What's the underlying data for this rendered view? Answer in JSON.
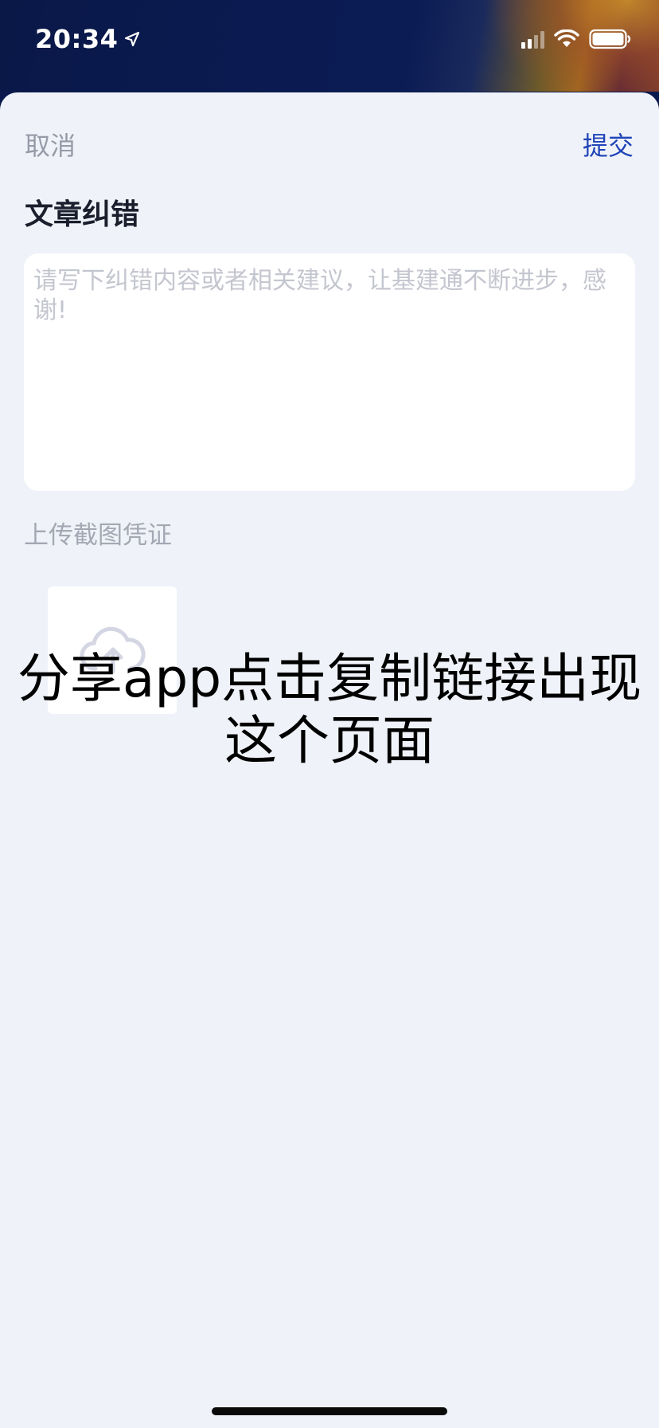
{
  "status_bar": {
    "time": "20:34",
    "icons": [
      "location-arrow-icon",
      "cellular-signal-icon",
      "wifi-icon",
      "battery-icon"
    ]
  },
  "header": {
    "cancel_label": "取消",
    "submit_label": "提交",
    "accent_color": "#1f44b8"
  },
  "form": {
    "title": "文章纠错",
    "textarea_value": "",
    "textarea_placeholder": "请写下纠错内容或者相关建议，让基建通不断进步，感谢!",
    "upload_label": "上传截图凭证",
    "upload_icon": "cloud-upload-icon"
  },
  "overlay": {
    "caption": "分享app点击复制链接出现这个页面"
  },
  "colors": {
    "background": "#eff2f8",
    "muted_text": "#979aa7",
    "title_text": "#1b1e2c"
  }
}
